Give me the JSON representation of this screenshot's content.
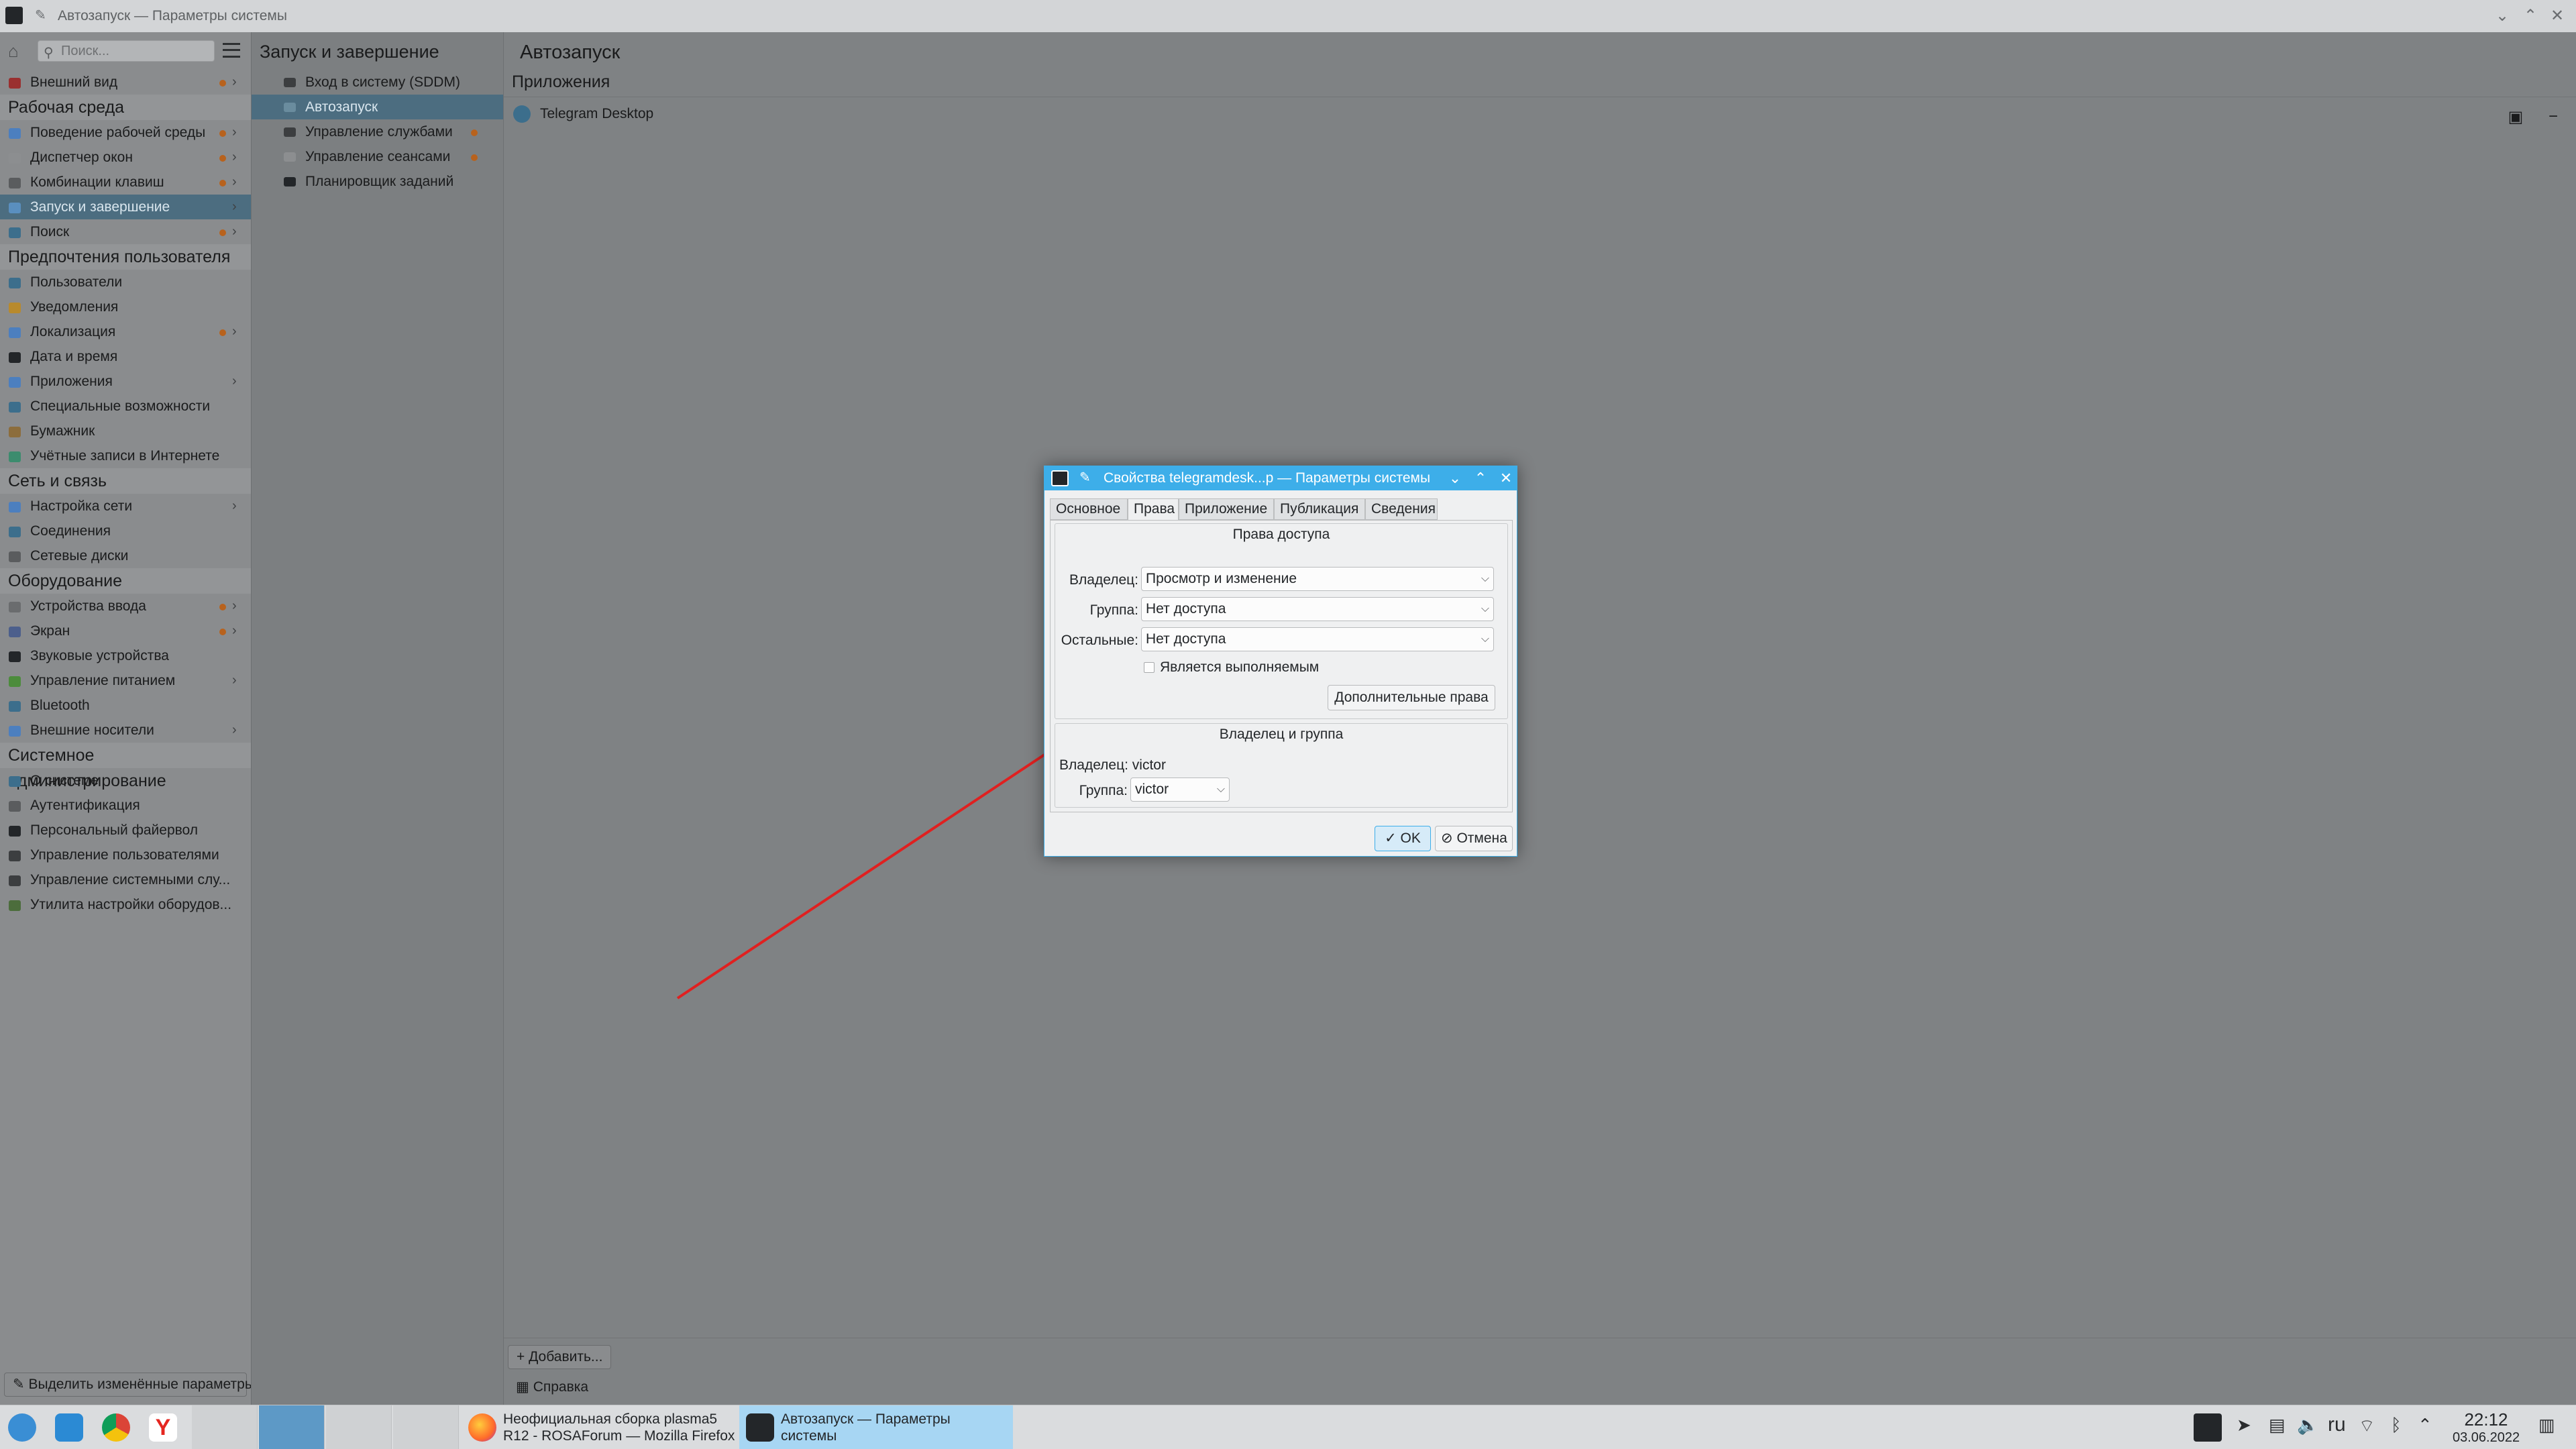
{
  "window": {
    "title": "Автозапуск — Параметры системы"
  },
  "sidebar": {
    "search_placeholder": "Поиск...",
    "items": [
      {
        "label": "Внешний вид",
        "color": "#9a3030",
        "dot": true,
        "chevron": true
      },
      {
        "category": "Рабочая среда"
      },
      {
        "label": "Поведение рабочей среды",
        "color": "#4c7fbf",
        "dot": true,
        "chevron": true
      },
      {
        "label": "Диспетчер окон",
        "color": "#8c8e90",
        "dot": true,
        "chevron": true
      },
      {
        "label": "Комбинации клавиш",
        "color": "#5a5c5e",
        "dot": true,
        "chevron": true
      },
      {
        "label": "Запуск и завершение",
        "color": "#5a8fbf",
        "dot": false,
        "chevron": true,
        "selected": true
      },
      {
        "label": "Поиск",
        "color": "#3c6e8c",
        "dot": true,
        "chevron": true
      },
      {
        "category": "Предпочтения пользователя"
      },
      {
        "label": "Пользователи",
        "color": "#3c6e8c"
      },
      {
        "label": "Уведомления",
        "color": "#b88a2d"
      },
      {
        "label": "Локализация",
        "color": "#4c7fbf",
        "dot": true,
        "chevron": true
      },
      {
        "label": "Дата и время",
        "color": "#232629"
      },
      {
        "label": "Приложения",
        "color": "#4c7fbf",
        "chevron": true
      },
      {
        "label": "Специальные возможности",
        "color": "#3c6e8c"
      },
      {
        "label": "Бумажник",
        "color": "#8c6d3c"
      },
      {
        "label": "Учётные записи в Интернете",
        "color": "#3c8c6e"
      },
      {
        "category": "Сеть и связь"
      },
      {
        "label": "Настройка сети",
        "color": "#4c7fbf",
        "chevron": true
      },
      {
        "label": "Соединения",
        "color": "#3c6e8c"
      },
      {
        "label": "Сетевые диски",
        "color": "#5a5c5e"
      },
      {
        "category": "Оборудование"
      },
      {
        "label": "Устройства ввода",
        "color": "#6a6c6e",
        "dot": true,
        "chevron": true
      },
      {
        "label": "Экран",
        "color": "#4c5f8c",
        "dot": true,
        "chevron": true
      },
      {
        "label": "Звуковые устройства",
        "color": "#232629"
      },
      {
        "label": "Управление питанием",
        "color": "#4c8c3c",
        "chevron": true
      },
      {
        "label": "Bluetooth",
        "color": "#3c6e8c"
      },
      {
        "label": "Внешние носители",
        "color": "#4c7fbf",
        "chevron": true
      },
      {
        "category": "Системное администрирование"
      },
      {
        "label": "О системе",
        "color": "#3c6e8c"
      },
      {
        "label": "Аутентификация",
        "color": "#5a5c5e"
      },
      {
        "label": "Персональный файервол",
        "color": "#232629"
      },
      {
        "label": "Управление пользователями",
        "color": "#3c3e40"
      },
      {
        "label": "Управление системными слу...",
        "color": "#3c3e40"
      },
      {
        "label": "Утилита настройки оборудов...",
        "color": "#4c6d3c"
      }
    ],
    "highlight_button": "Выделить изменённые параметры"
  },
  "midpane": {
    "title": "Запуск и завершение",
    "items": [
      {
        "label": "Вход в систему (SDDM)",
        "color": "#3c3e40"
      },
      {
        "label": "Автозапуск",
        "color": "#6a8c9e",
        "selected": true
      },
      {
        "label": "Управление службами",
        "color": "#3c3e40",
        "dot": true
      },
      {
        "label": "Управление сеансами",
        "color": "#8c8e90",
        "dot": true
      },
      {
        "label": "Планировщик заданий",
        "color": "#232629"
      }
    ]
  },
  "main": {
    "title": "Автозапуск",
    "section": "Приложения",
    "apps": [
      {
        "label": "Telegram Desktop"
      }
    ],
    "add_button": "+ Добавить...",
    "help_button": "Справка"
  },
  "dialog": {
    "title": "Свойства telegramdesk...p — Параметры системы",
    "tabs": [
      "Основное",
      "Права",
      "Приложение",
      "Публикация",
      "Сведения"
    ],
    "active_tab": "Права",
    "access_group_title": "Права доступа",
    "owner_label": "Владелец:",
    "owner_value": "Просмотр и изменение",
    "group_label": "Группа:",
    "group_value": "Нет доступа",
    "others_label": "Остальные:",
    "others_value": "Нет доступа",
    "executable_label": "Является выполняемым",
    "executable_checked": false,
    "advanced_button": "Дополнительные права",
    "owner_group_title": "Владелец и группа",
    "owner_user_label": "Владелец: victor",
    "group_select_label": "Группа:",
    "group_select_value": "victor",
    "ok_button": "OK",
    "cancel_button": "Отмена"
  },
  "taskbar": {
    "tasks": [
      {
        "label": "Неофициальная сборка plasma5 R12 - ROSAForum — Mozilla Firefox",
        "line1": "Неофициальная сборка plasma5",
        "line2": "R12 - ROSAForum — Mozilla Firefox"
      },
      {
        "label": "Автозапуск — Параметры системы",
        "line1": "Автозапуск  — Параметры",
        "line2": "системы",
        "active": true
      }
    ],
    "keyboard_layout": "ru",
    "time": "22:12",
    "date": "03.06.2022"
  },
  "colors": {
    "accent": "#3daee9",
    "annotation_arrow": "#e02020",
    "selection": "#4c6d80"
  }
}
